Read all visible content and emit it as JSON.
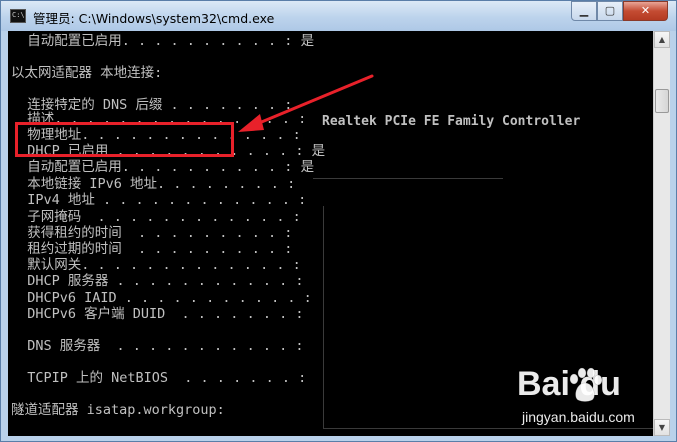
{
  "window": {
    "title": "管理员: C:\\Windows\\system32\\cmd.exe",
    "buttons": {
      "minimize": "▁",
      "maximize": "▢",
      "close": "✕"
    }
  },
  "console": {
    "lines": [
      "  自动配置已启用. . . . . . . . . . : 是",
      "",
      "以太网适配器 本地连接:",
      "",
      "  连接特定的 DNS 后缀 . . . . . . . :",
      "  描述. . . . . . . . . . . . . . . :",
      "  物理地址. . . . . . . . . . . . . :",
      "  DHCP 已启用 . . . . . . . . . . . : 是",
      "  自动配置已启用. . . . . . . . . . : 是",
      "  本地链接 IPv6 地址. . . . . . . . :",
      "  IPv4 地址 . . . . . . . . . . . . :",
      "  子网掩码  . . . . . . . . . . . . :",
      "  获得租约的时间  . . . . . . . . . :",
      "  租约过期的时间  . . . . . . . . . :",
      "  默认网关. . . . . . . . . . . . . :",
      "  DHCP 服务器 . . . . . . . . . . . :",
      "  DHCPv6 IAID . . . . . . . . . . . :",
      "  DHCPv6 客户端 DUID  . . . . . . . :",
      "",
      "  DNS 服务器  . . . . . . . . . . . :",
      "",
      "  TCPIP 上的 NetBIOS  . . . . . . . :",
      "",
      "隧道适配器 isatap.workgroup:"
    ],
    "adapter_description": "Realtek PCIe FE Family Controller"
  },
  "annotation": {
    "color": "#e8212a"
  },
  "watermark": {
    "logo": "Bai  du",
    "url": "jingyan.baidu.com"
  }
}
